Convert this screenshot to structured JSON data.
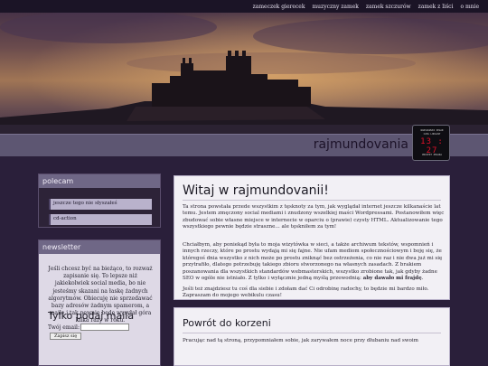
{
  "nav": {
    "items": [
      "zameczek gierecek",
      "muzyczny zamek",
      "zamek szczurów",
      "zamek z liści",
      "o mnie"
    ]
  },
  "header": {
    "site_title": "rajmundovania"
  },
  "clock": {
    "line1": "WARSZAWSKI ZEGAR",
    "line2": "CZAS LOKALNY",
    "digits": "13 : 27",
    "line3": "PROJEKT ZEGARA"
  },
  "sidebar": {
    "polecam": {
      "heading": "polecam",
      "items": [
        "jeszcze tego nie słyszałeś",
        "cd-action"
      ]
    },
    "newsletter": {
      "heading": "newsletter",
      "text": "Jeśli chcesz być na bieżąco, to rozważ zapisanie się. To lepsze niż jakiekolwiek social media, bo nie jesteśmy skazani na łaskę żadnych algorytmów. Obiecuję nie sprzedawać bazy adresów żadnym spamerom, a maile i tak pewnie będę wysyłał góra kilka razy w roku.",
      "form_title": "Tylko podaj maila",
      "email_label": "Twój email:",
      "submit_label": "Zapisz się"
    }
  },
  "main": {
    "intro": {
      "title": "Witaj w rajmundovanii!",
      "p1": "Ta strona powstała przede wszystkim z tęsknoty za tym, jak wyglądał internet jeszcze kilkanaście lat temu. Jestem zmęczony social mediami i znudzony wszelkiej maści Wordpressami. Postanowiłem więc zbudować sobie własne miejsce w internecie w oparciu o (prawie) czysty HTML. Aktualizowanie tego wszystkiego pewnie będzie straszne... ale tęskniłem za tym!",
      "p2_a": "Chciałbym, aby poniekąd była to moja wizytówka w sieci, a także archiwum tekstów, wspomnień i innych rzeczy, które po prostu wydają mi się fajne. Nie ufam mediom społecznościowym i boję się, że któregoś dnia wszystko z nich może po prostu zniknąć bez ostrzeżenia, co nie raz i nie dwa już mi się przytrafiło, dlatego potrzebuję takiego zbioru stworzonego na własnych zasadach. Z brakiem poszanowania dla wszystkich standardów webmasterskich, wszystko zrobione tak, jak gdyby żadne SEO w ogóle nie istniało. Z tylko i wyłącznie jedną myślą przewodnią: ",
      "p2_bold": "aby dawało mi frajdę",
      "p2_end": ".",
      "p3": "Jeśli też znajdziesz tu coś dla siebie i zdołam dać Ci odrobinę radochy, to będzie mi bardzo miło. Zapraszam do mojego webikulu czasu!"
    },
    "second": {
      "title": "Powrót do korzeni",
      "p1": "Pracując nad tą stroną, przypomniałem sobie, jak zarywałem noce przy dłubaniu nad swoim"
    }
  }
}
